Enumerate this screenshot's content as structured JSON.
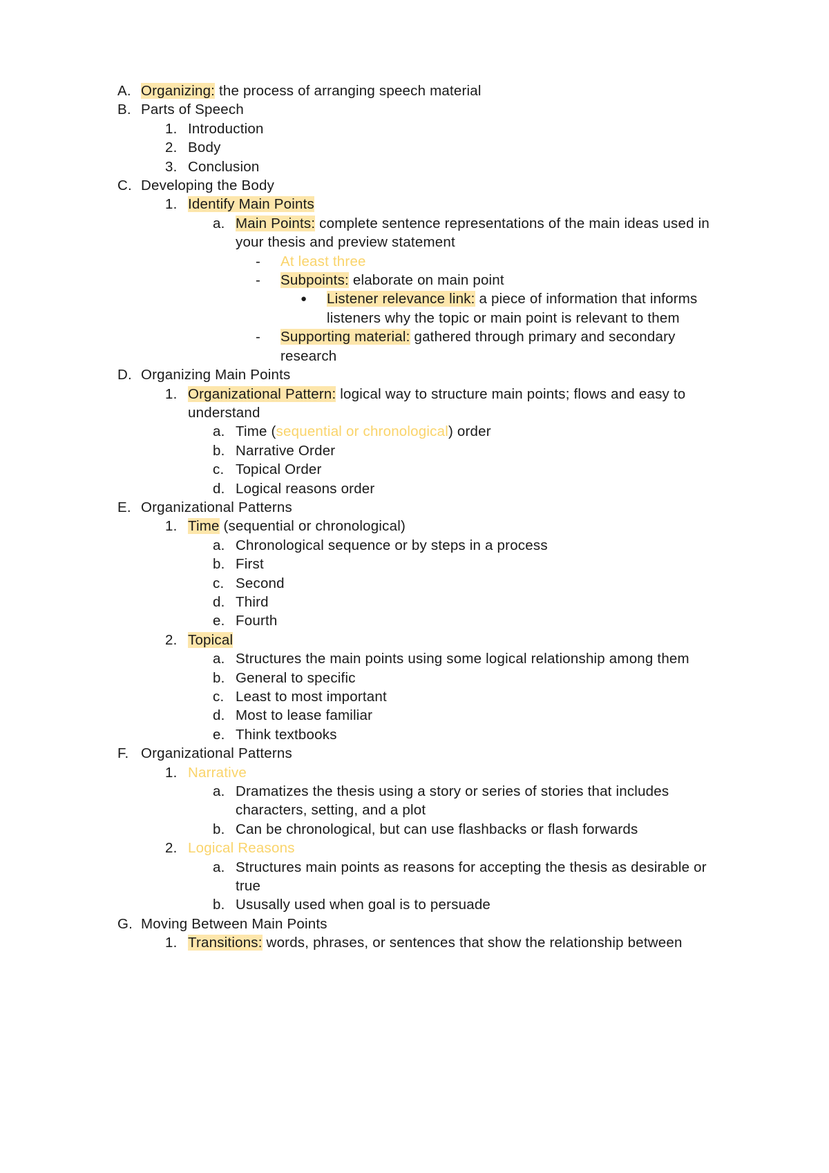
{
  "document": {
    "type": "outline-notes",
    "highlight_color": "#fde6ab",
    "accent_text_color": "#fad46b",
    "body_text_color": "#1a1a1a",
    "background_color": "#ffffff"
  },
  "items": {
    "a": {
      "marker": "A.",
      "highlight": "Organizing:",
      "rest": " the process of arranging speech material"
    },
    "b": {
      "marker": "B.",
      "text": "Parts of Speech"
    },
    "b1": {
      "marker": "1.",
      "text": "Introduction"
    },
    "b2": {
      "marker": "2.",
      "text": "Body"
    },
    "b3": {
      "marker": "3.",
      "text": "Conclusion"
    },
    "c": {
      "marker": "C.",
      "text": "Developing the Body"
    },
    "c1": {
      "marker": "1.",
      "highlight": "Identify Main Points"
    },
    "c1a": {
      "marker": "a.",
      "highlight": "Main Points:",
      "rest": " complete sentence representations of the main ideas used in your thesis and preview statement"
    },
    "c1a_dash1": {
      "marker": "-",
      "orange": "At least three"
    },
    "c1a_dash2": {
      "marker": "-",
      "highlight": "Subpoints:",
      "rest": " elaborate on main point"
    },
    "c1a_bullet1": {
      "marker": "●",
      "highlight": "Listener relevance link:",
      "rest": " a piece of information that informs listeners why the topic or main point is relevant to them"
    },
    "c1a_dash3": {
      "marker": "-",
      "highlight": "Supporting material:",
      "rest": " gathered through primary and secondary research"
    },
    "d": {
      "marker": "D.",
      "text": "Organizing Main Points"
    },
    "d1": {
      "marker": "1.",
      "highlight": "Organizational Pattern:",
      "rest": " logical way to structure main points; flows and easy to understand"
    },
    "d1a": {
      "marker": "a.",
      "pre": "Time (",
      "orange": "sequential or chronological",
      "post": ") order"
    },
    "d1b": {
      "marker": "b.",
      "text": "Narrative Order"
    },
    "d1c": {
      "marker": "c.",
      "text": "Topical Order"
    },
    "d1d": {
      "marker": "d.",
      "text": "Logical reasons order"
    },
    "e": {
      "marker": "E.",
      "text": "Organizational Patterns"
    },
    "e1": {
      "marker": "1.",
      "highlight": "Time",
      "rest": " (sequential or chronological)"
    },
    "e1a": {
      "marker": "a.",
      "text": "Chronological sequence or by steps in a process"
    },
    "e1b": {
      "marker": "b.",
      "text": "First"
    },
    "e1c": {
      "marker": "c.",
      "text": "Second"
    },
    "e1d": {
      "marker": "d.",
      "text": "Third"
    },
    "e1e": {
      "marker": "e.",
      "text": "Fourth"
    },
    "e2": {
      "marker": "2.",
      "highlight": "Topical"
    },
    "e2a": {
      "marker": "a.",
      "text": "Structures the main points using some logical relationship among them"
    },
    "e2b": {
      "marker": "b.",
      "text": "General to specific"
    },
    "e2c": {
      "marker": "c.",
      "text": "Least to most important"
    },
    "e2d": {
      "marker": "d.",
      "text": "Most to lease familiar"
    },
    "e2e": {
      "marker": "e.",
      "text": "Think textbooks"
    },
    "f": {
      "marker": "F.",
      "text": "Organizational Patterns"
    },
    "f1": {
      "marker": "1.",
      "orange": "Narrative"
    },
    "f1a": {
      "marker": "a.",
      "text": "Dramatizes the thesis using a story or series of stories that includes characters, setting, and a plot"
    },
    "f1b": {
      "marker": "b.",
      "text": "Can be chronological, but can use flashbacks or flash forwards"
    },
    "f2": {
      "marker": "2.",
      "orange": "Logical Reasons"
    },
    "f2a": {
      "marker": "a.",
      "text": "Structures main points as reasons for accepting the thesis as desirable or true"
    },
    "f2b": {
      "marker": "b.",
      "text": "Ususally used when goal is to persuade"
    },
    "g": {
      "marker": "G.",
      "text": "Moving Between Main Points"
    },
    "g1": {
      "marker": "1.",
      "highlight": "Transitions:",
      "rest": " words, phrases, or sentences that show the relationship between"
    }
  }
}
